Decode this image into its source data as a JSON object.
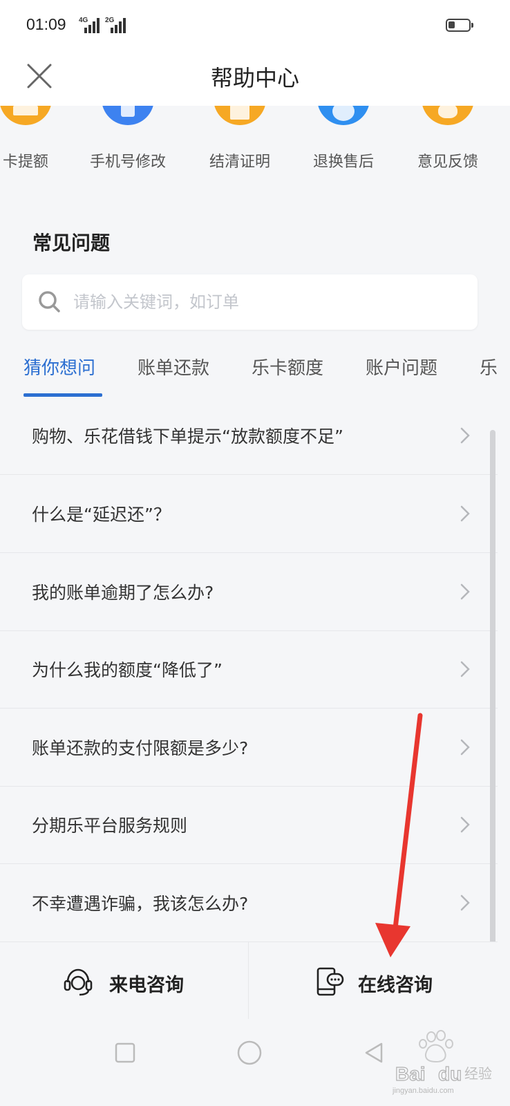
{
  "status_bar": {
    "time": "01:09",
    "network_1": "4G",
    "network_2": "2G",
    "battery_level": 0.3
  },
  "header": {
    "title": "帮助中心",
    "close_icon": "close-icon"
  },
  "quick_actions": [
    {
      "label": "卡提额",
      "icon": "card-icon",
      "color": "#f6a824"
    },
    {
      "label": "手机号修改",
      "icon": "phone-icon",
      "color": "#3d82f0"
    },
    {
      "label": "结清证明",
      "icon": "certificate-icon",
      "color": "#f6a824"
    },
    {
      "label": "退换售后",
      "icon": "refund-icon",
      "color": "#2f8ff0"
    },
    {
      "label": "意见反馈",
      "icon": "feedback-icon",
      "color": "#f6a824"
    }
  ],
  "faq": {
    "section_title": "常见问题",
    "search_placeholder": "请输入关键词，如订单",
    "search_value": "",
    "tabs": [
      {
        "label": "猜你想问",
        "active": true
      },
      {
        "label": "账单还款",
        "active": false
      },
      {
        "label": "乐卡额度",
        "active": false
      },
      {
        "label": "账户问题",
        "active": false
      },
      {
        "label": "乐",
        "active": false
      }
    ],
    "items": [
      "购物、乐花借钱下单提示“放款额度不足”",
      "什么是“延迟还”？",
      "我的账单逾期了怎么办?",
      "为什么我的额度“降低了”",
      "账单还款的支付限额是多少?",
      "分期乐平台服务规则",
      "不幸遭遇诈骗，我该怎么办?"
    ]
  },
  "bottom_actions": {
    "phone_label": "来电咨询",
    "online_label": "在线咨询"
  },
  "watermark": {
    "text": "jingyan.baidu.com"
  },
  "colors": {
    "accent": "#2c6fd1",
    "arrow": "#e8362f",
    "background": "#f5f6f8"
  }
}
